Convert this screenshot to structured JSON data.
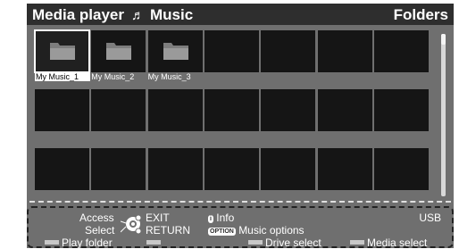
{
  "header": {
    "title_left": "Media player",
    "title_section": "Music",
    "title_right": "Folders"
  },
  "folders": [
    {
      "label": "My Music_1",
      "selected": true
    },
    {
      "label": "My Music_2",
      "selected": false
    },
    {
      "label": "My Music_3",
      "selected": false
    }
  ],
  "grid": {
    "rows": 3,
    "cols": 7
  },
  "scrollbar": {
    "position": 0.0
  },
  "footer": {
    "access_label": "Access",
    "select_label": "Select",
    "exit_label": "EXIT",
    "return_label": "RETURN",
    "info_key": "i",
    "info_label": "Info",
    "options_key": "OPTION",
    "options_label": "Music options",
    "device_label": "USB",
    "play_folder_label": "Play folder",
    "drive_select_label": "Drive select",
    "media_select_label": "Media select"
  },
  "colors": {
    "screen_bg": "#6f6f6f",
    "titlebar_bg": "#2e2e2e",
    "tile_bg": "#151515",
    "folder_icon": "#9a9a9a"
  },
  "icons": {
    "title_icon": "music-note-icon",
    "folder_icon": "folder-icon",
    "nav_icon": "dpad-icon"
  }
}
